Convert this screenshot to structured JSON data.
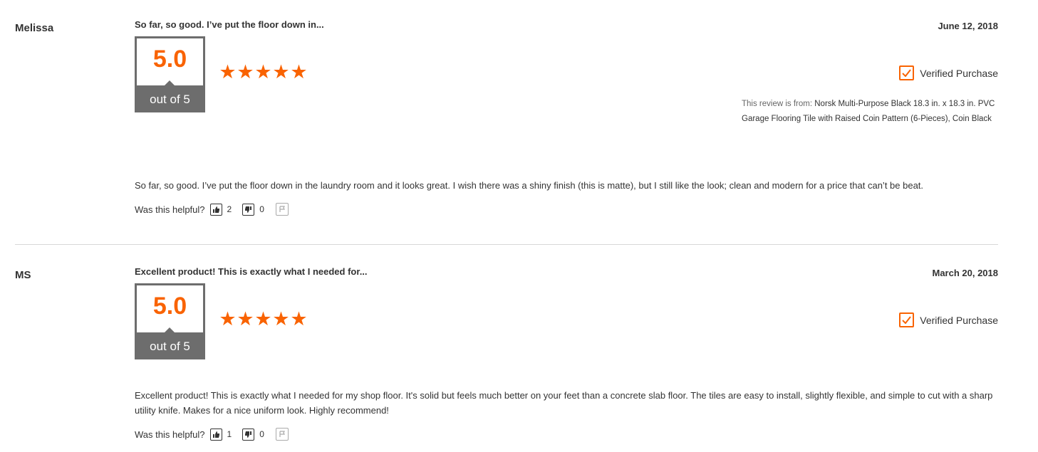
{
  "reviews": [
    {
      "reviewer": "Melissa",
      "headline": "So far, so good. I’ve put the floor down in...",
      "date": "June 12, 2018",
      "score": "5.0",
      "score_suffix": "out of 5",
      "rating": 5,
      "verified_label": "Verified Purchase",
      "review_from_prefix": "This review is from: ",
      "review_from_product": "Norsk Multi-Purpose Black 18.3 in. x 18.3 in. PVC Garage Flooring Tile with Raised Coin Pattern (6-Pieces), Coin Black",
      "body": "So far, so good. I’ve put the floor down in the laundry room and it looks great. I wish there was a shiny finish (this is matte), but I still like the look; clean and modern for a price that can’t be beat.",
      "helpful_label": "Was this helpful?",
      "helpful_up": "2",
      "helpful_down": "0"
    },
    {
      "reviewer": "MS",
      "headline": "Excellent product! This is exactly what I needed for...",
      "date": "March 20, 2018",
      "score": "5.0",
      "score_suffix": "out of 5",
      "rating": 5,
      "verified_label": "Verified Purchase",
      "body": "Excellent product! This is exactly what I needed for my shop floor. It's solid but feels much better on your feet than a concrete slab floor. The tiles are easy to install, slightly flexible, and simple to cut with a sharp utility knife. Makes for a nice uniform look. Highly recommend!",
      "helpful_label": "Was this helpful?",
      "helpful_up": "1",
      "helpful_down": "0"
    }
  ],
  "colors": {
    "accent": "#f96302",
    "score_frame": "#6d6d6d",
    "divider": "#d8d8d8"
  },
  "icons": {
    "star": "star-icon",
    "check": "checkmark-icon",
    "thumbs_up": "thumbs-up-icon",
    "thumbs_down": "thumbs-down-icon",
    "flag": "flag-icon"
  }
}
